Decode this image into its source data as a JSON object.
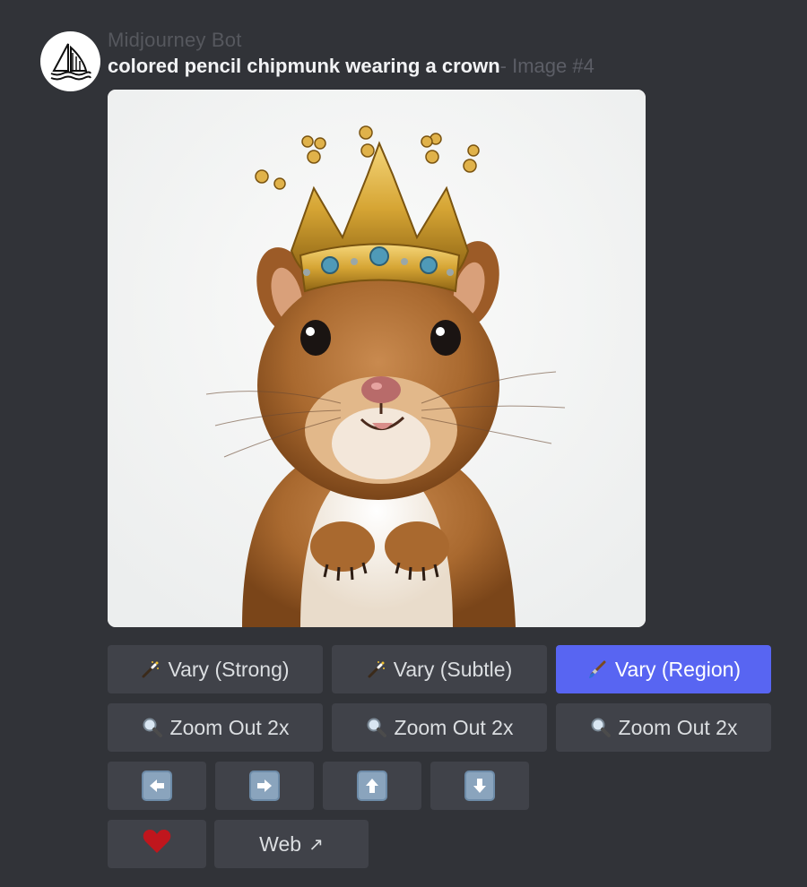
{
  "message": {
    "author": "Midjourney Bot",
    "prompt": "colored pencil chipmunk wearing a crown",
    "suffix": "- Image #4"
  },
  "buttons": {
    "vary_strong": "Vary (Strong)",
    "vary_subtle": "Vary (Subtle)",
    "vary_region": "Vary (Region)",
    "zoom_1": "Zoom Out 2x",
    "zoom_2": "Zoom Out 2x",
    "zoom_3": "Zoom Out 2x",
    "web": "Web",
    "web_icon": "↗"
  },
  "icons": {
    "avatar": "sailboat-icon",
    "vary": "magic-wand-icon",
    "region": "paintbrush-icon",
    "zoom": "magnifier-icon",
    "left": "arrow-left-icon",
    "right": "arrow-right-icon",
    "up": "arrow-up-icon",
    "down": "arrow-down-icon",
    "favorite": "heart-icon"
  },
  "colors": {
    "background": "#313338",
    "button": "#404249",
    "primary_button": "#5865f2",
    "heart": "#c0161d"
  }
}
